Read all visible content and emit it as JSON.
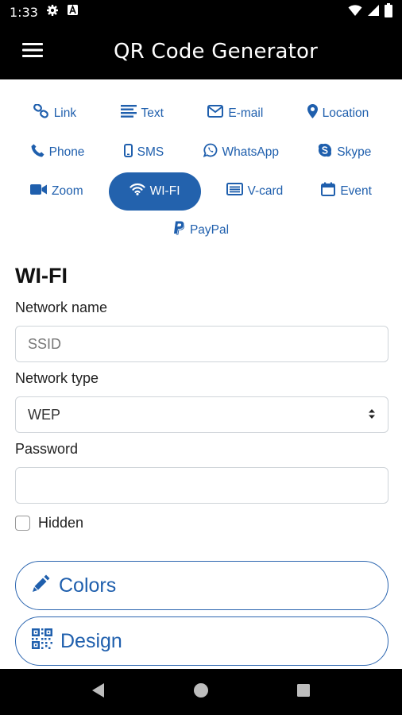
{
  "status_bar": {
    "time": "1:33",
    "icons": [
      "gear-icon",
      "a-box-icon",
      "wifi-icon",
      "signal-icon",
      "battery-icon"
    ]
  },
  "app_bar": {
    "title": "QR Code Generator",
    "menu_icon": "hamburger-icon"
  },
  "types": [
    [
      {
        "label": "Link",
        "icon": "link-icon"
      },
      {
        "label": "Text",
        "icon": "text-lines-icon"
      },
      {
        "label": "E-mail",
        "icon": "envelope-icon"
      },
      {
        "label": "Location",
        "icon": "map-pin-icon"
      }
    ],
    [
      {
        "label": "Phone",
        "icon": "phone-icon"
      },
      {
        "label": "SMS",
        "icon": "mobile-icon"
      },
      {
        "label": "WhatsApp",
        "icon": "whatsapp-icon"
      },
      {
        "label": "Skype",
        "icon": "skype-icon"
      }
    ],
    [
      {
        "label": "Zoom",
        "icon": "video-camera-icon"
      },
      {
        "label": "WI-FI",
        "icon": "wifi-icon",
        "active": true
      },
      {
        "label": "V-card",
        "icon": "id-card-icon"
      },
      {
        "label": "Event",
        "icon": "calendar-icon"
      }
    ],
    [
      {
        "label": "PayPal",
        "icon": "paypal-icon"
      }
    ]
  ],
  "form": {
    "title": "WI-FI",
    "network_name_label": "Network name",
    "network_name_placeholder": "SSID",
    "network_type_label": "Network type",
    "network_type_value": "WEP",
    "password_label": "Password",
    "password_value": "",
    "hidden_label": "Hidden",
    "hidden_checked": false
  },
  "buttons": {
    "colors_label": "Colors",
    "design_label": "Design"
  },
  "colors": {
    "accent": "#2362ad",
    "accent_text": "#1f5fad",
    "bar": "#000000"
  }
}
